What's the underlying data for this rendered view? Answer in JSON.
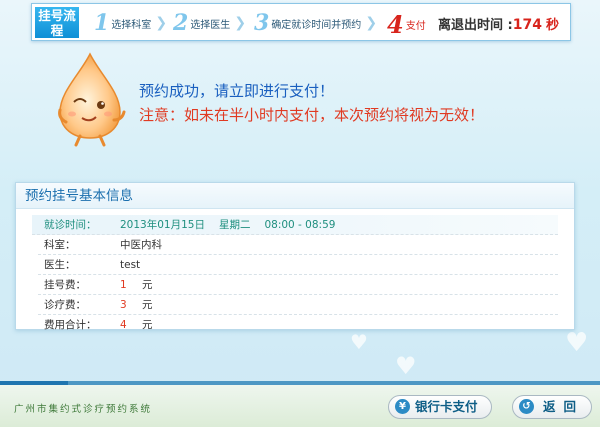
{
  "stepbar": {
    "label": "挂号流程",
    "steps": [
      {
        "num": "1",
        "text": "选择科室",
        "active": false
      },
      {
        "num": "2",
        "text": "选择医生",
        "active": false
      },
      {
        "num": "3",
        "text": "确定就诊时间并预约",
        "active": false
      },
      {
        "num": "4",
        "text": "支付",
        "active": true
      }
    ],
    "countdown_label": "离退出时间 :",
    "countdown_value": "174",
    "countdown_unit": "秒"
  },
  "message": {
    "success": "预约成功，请立即进行支付！",
    "warning": "注意：如未在半小时内支付，本次预约将视为无效！"
  },
  "panel": {
    "title": "预约挂号基本信息",
    "visit_time_label": "就诊时间：",
    "visit_date": "2013年01月15日",
    "visit_weekday": "星期二",
    "visit_slot": "08:00 - 08:59",
    "dept_label": "科室：",
    "dept_value": "中医内科",
    "doctor_label": "医生：",
    "doctor_value": "test",
    "reg_fee_label": "挂号费：",
    "reg_fee_value": "1",
    "diag_fee_label": "诊疗费：",
    "diag_fee_value": "3",
    "total_label": "费用合计：",
    "total_value": "4",
    "currency": "元"
  },
  "footer": {
    "system_name": "广州市集约式诊疗预约系统",
    "pay_button": "银行卡支付",
    "back_button": "返回",
    "pay_icon": "yen-icon",
    "back_icon": "back-icon"
  },
  "colors": {
    "accent_blue": "#1a5fbf",
    "warning_red": "#e03a22",
    "countdown_red": "#d8241c"
  }
}
